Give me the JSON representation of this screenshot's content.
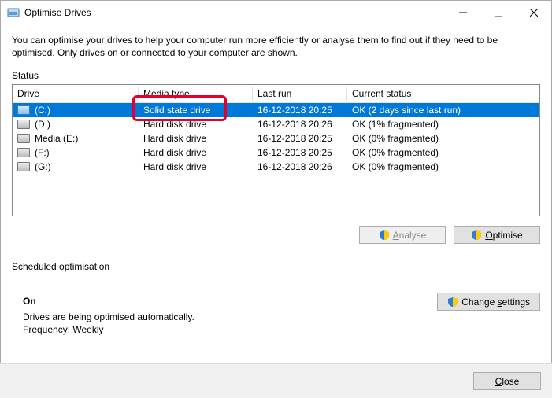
{
  "window": {
    "title": "Optimise Drives",
    "intro": "You can optimise your drives to help your computer run more efficiently or analyse them to find out if they need to be optimised. Only drives on or connected to your computer are shown."
  },
  "status": {
    "label": "Status",
    "columns": {
      "drive": "Drive",
      "media": "Media type",
      "last": "Last run",
      "cstat": "Current status"
    },
    "rows": [
      {
        "icon": "ssd",
        "name": "(C:)",
        "media": "Solid state drive",
        "last": "16-12-2018 20:25",
        "status": "OK (2 days since last run)",
        "selected": true
      },
      {
        "icon": "hdd",
        "name": "(D:)",
        "media": "Hard disk drive",
        "last": "16-12-2018 20:26",
        "status": "OK (1% fragmented)"
      },
      {
        "icon": "hdd",
        "name": "Media (E:)",
        "media": "Hard disk drive",
        "last": "16-12-2018 20:25",
        "status": "OK (0% fragmented)"
      },
      {
        "icon": "hdd",
        "name": "(F:)",
        "media": "Hard disk drive",
        "last": "16-12-2018 20:25",
        "status": "OK (0% fragmented)"
      },
      {
        "icon": "hdd",
        "name": "(G:)",
        "media": "Hard disk drive",
        "last": "16-12-2018 20:26",
        "status": "OK (0% fragmented)"
      }
    ]
  },
  "buttons": {
    "analyse": "Analyse",
    "optimise": "Optimise",
    "change_settings": "Change settings",
    "close": "Close"
  },
  "schedule": {
    "label": "Scheduled optimisation",
    "state": "On",
    "desc": "Drives are being optimised automatically.",
    "freq": "Frequency: Weekly"
  }
}
